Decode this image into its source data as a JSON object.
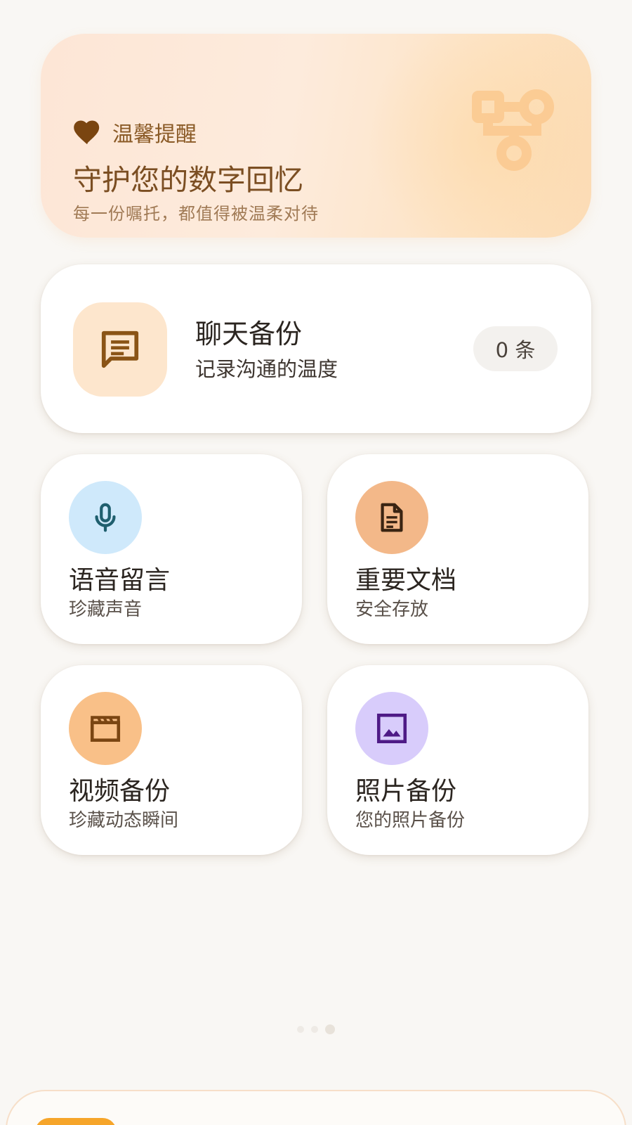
{
  "banner": {
    "tag": "温馨提醒",
    "title": "守护您的数字回忆",
    "subtitle": "每一份嘱托，都值得被温柔对待",
    "icons": {
      "tag": "heart-icon",
      "decoration": "account-tree-icon"
    }
  },
  "chat_card": {
    "title": "聊天备份",
    "subtitle": "记录沟通的温度",
    "count": "0 条",
    "icon": "chat-icon"
  },
  "tiles": [
    {
      "title": "语音留言",
      "subtitle": "珍藏声音",
      "icon": "microphone-icon",
      "color": "#cfe9fb",
      "icon_color": "#1f5f6e"
    },
    {
      "title": "重要文档",
      "subtitle": "安全存放",
      "icon": "document-icon",
      "color": "#f3b889",
      "icon_color": "#3a2412"
    },
    {
      "title": "视频备份",
      "subtitle": "珍藏动态瞬间",
      "icon": "clapperboard-icon",
      "color": "#f9c088",
      "icon_color": "#7a4512"
    },
    {
      "title": "照片备份",
      "subtitle": "您的照片备份",
      "icon": "image-icon",
      "color": "#d8ccfb",
      "icon_color": "#4e1a86"
    }
  ],
  "pager": {
    "count": 3,
    "active": 2
  },
  "colors": {
    "background": "#f9f7f4",
    "banner_accent": "#7b4e22",
    "chat_icon_bg": "#fde6cd",
    "chat_icon": "#8a5416",
    "bottom_pill": "#f6a52a"
  }
}
